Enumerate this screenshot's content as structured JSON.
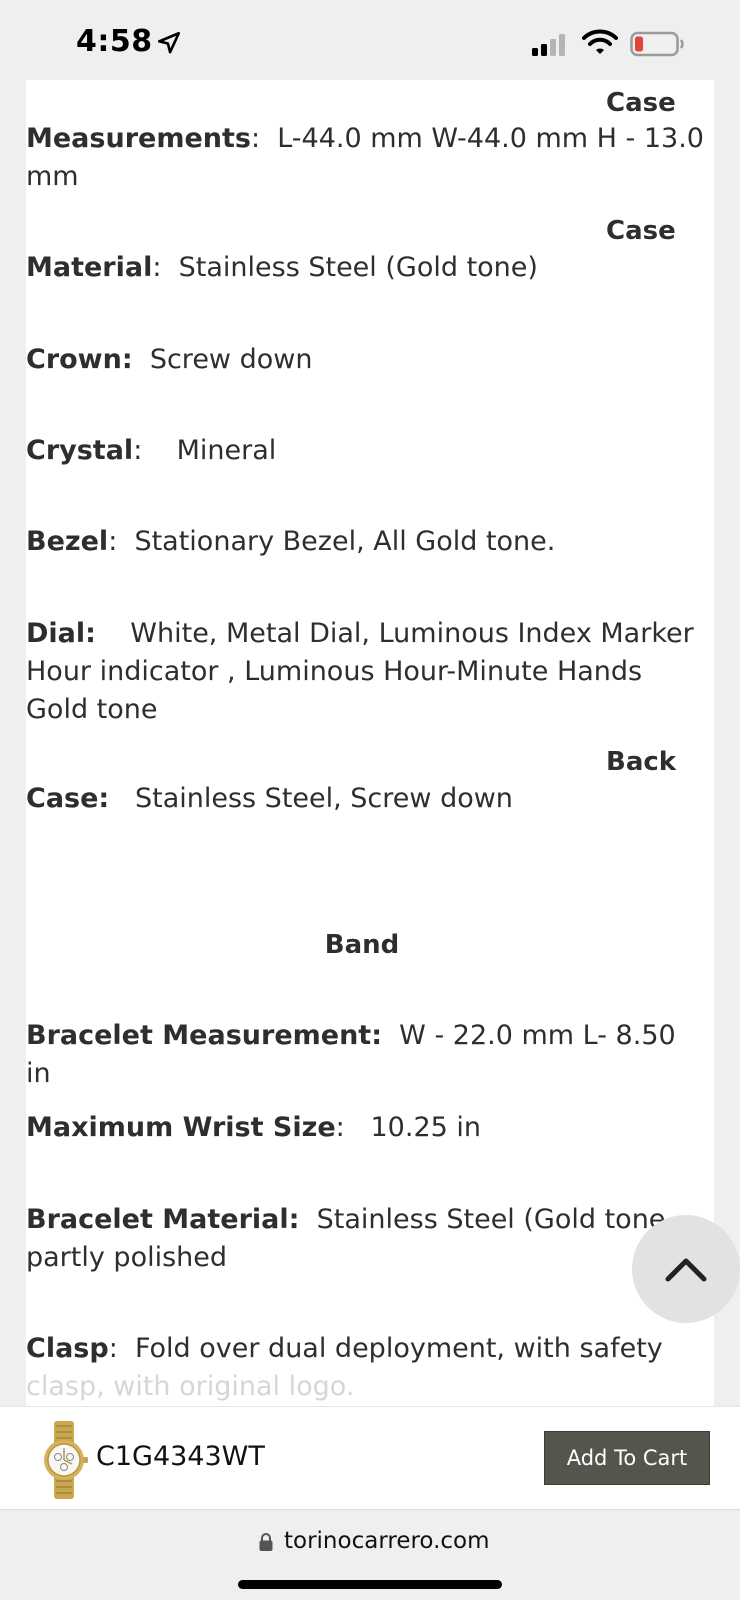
{
  "status_bar": {
    "time": "4:58",
    "icons": [
      "location-arrow-icon",
      "cellular-signal-icon",
      "wifi-icon",
      "battery-low-icon"
    ],
    "battery_color": "#e0443a"
  },
  "specs": {
    "case_label_1": "Case",
    "measurements_label": "Measurements",
    "measurements_value": "L-44.0 mm  W-44.0 mm H - 13.0",
    "measurements_value_cont": "mm",
    "case_label_2": "Case",
    "material_label": "Material",
    "material_value": "Stainless Steel (Gold tone)",
    "crown_label": "Crown:",
    "crown_value": "Screw down",
    "crystal_label": "Crystal",
    "crystal_value": "Mineral",
    "bezel_label": "Bezel",
    "bezel_value": "Stationary Bezel, All Gold tone.",
    "dial_label": "Dial:",
    "dial_value_line1": "White, Metal Dial, Luminous Index Marker",
    "dial_value_line2": "Hour indicator , Luminous Hour-Minute Hands",
    "dial_value_line3": "Gold tone",
    "back_label": "Back",
    "case_back_label": "Case:",
    "case_back_value": "Stainless Steel, Screw down",
    "band_heading": "Band",
    "bracelet_measurement_label": "Bracelet Measurement:",
    "bracelet_measurement_value": "W - 22.0 mm L- 8.50 in",
    "max_wrist_label": "Maximum Wrist Size",
    "max_wrist_value": "10.25 in",
    "bracelet_material_label": "Bracelet Material:",
    "bracelet_material_value": "Stainless Steel (Gold tone",
    "bracelet_material_cont": "partly polished",
    "clasp_label": "Clasp",
    "clasp_value": "Fold over dual deployment, with safety",
    "clasp_cont": "clasp, with original logo."
  },
  "product_bar": {
    "sku": "C1G4343WT",
    "add_to_cart_label": "Add To Cart"
  },
  "address_bar": {
    "url": "torinocarrero.com"
  }
}
